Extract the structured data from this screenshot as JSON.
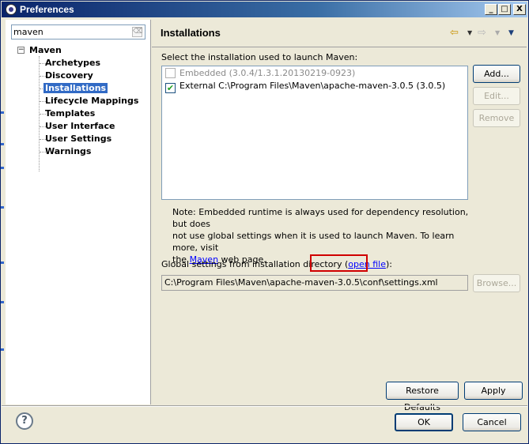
{
  "window": {
    "title": "Preferences",
    "controls": {
      "minimize": "_",
      "maximize": "□",
      "close": "X"
    }
  },
  "sidebar": {
    "filter_value": "maven",
    "expander": "−",
    "root": "Maven",
    "items": [
      "Archetypes",
      "Discovery",
      "Installations",
      "Lifecycle Mappings",
      "Templates",
      "User Interface",
      "User Settings",
      "Warnings"
    ],
    "selected": "Installations"
  },
  "header": {
    "title": "Installations",
    "icons": [
      "back-arrow-icon",
      "dropdown-icon",
      "forward-arrow-icon",
      "dropdown-icon",
      "view-menu-icon"
    ],
    "back_glyph": "⇦",
    "forward_glyph": "⇨",
    "drop_glyph": "▼"
  },
  "main": {
    "select_label": "Select the installation used to launch Maven:",
    "installations": [
      {
        "label": "Embedded (3.0.4/1.3.1.20130219-0923)",
        "checked": false,
        "enabled": false
      },
      {
        "label": "External C:\\Program Files\\Maven\\apache-maven-3.0.5 (3.0.5)",
        "checked": true,
        "enabled": true
      }
    ],
    "check_glyph": "✔",
    "buttons": {
      "add": "Add...",
      "edit": "Edit...",
      "remove": "Remove"
    },
    "note_line1": "Note: Embedded runtime is always used for dependency resolution, but does",
    "note_line2": "not use global settings when it is used to launch Maven. To learn more, visit",
    "note_line3_pre": "the ",
    "note_link": "Maven",
    "note_line3_post": " web page.",
    "global_label_pre": "Global settings from installation directory (",
    "global_link": "open file",
    "global_label_post": "):",
    "global_path": "C:\\Program Files\\Maven\\apache-maven-3.0.5\\conf\\settings.xml",
    "browse": "Browse...",
    "restore_defaults": "Restore Defaults",
    "apply": "Apply"
  },
  "footer": {
    "help": "?",
    "ok": "OK",
    "cancel": "Cancel"
  }
}
